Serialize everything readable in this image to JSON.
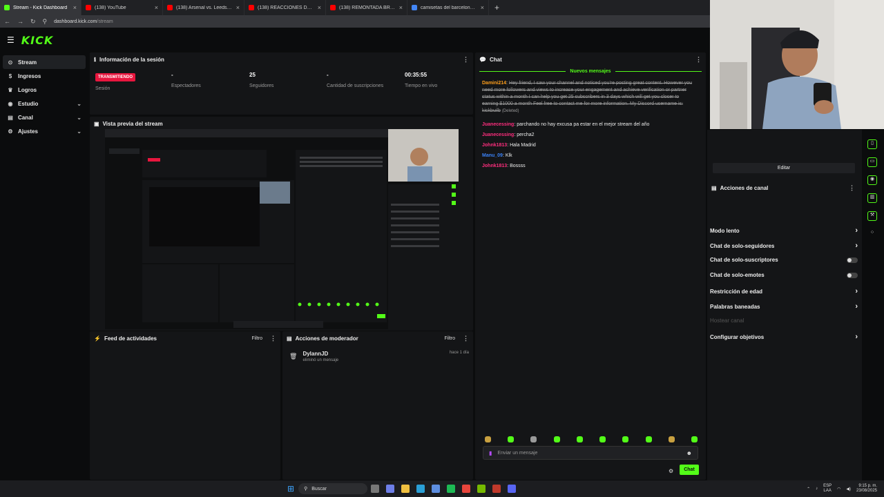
{
  "browser": {
    "tabs": [
      {
        "title": "Stream - Kick Dashboard",
        "color": "#53fc18"
      },
      {
        "title": "(138) YouTube",
        "color": "#ff0000"
      },
      {
        "title": "(138) Arsenal vs. Leeds | Highlig...",
        "color": "#ff0000"
      },
      {
        "title": "(138) REACCIONES DE UN HINC...",
        "color": "#ff0000"
      },
      {
        "title": "(138) REMONTADA BRUTAL DE...",
        "color": "#ff0000"
      },
      {
        "title": "camisetas del barcelona 2025 -",
        "color": "#4285f4"
      }
    ],
    "url_host": "dashboard.kick.com",
    "url_path": "/stream"
  },
  "app": {
    "logo": "KICK",
    "accent": "#53fc18"
  },
  "sidebar": {
    "items": [
      {
        "label": "Stream",
        "icon": "stream-icon",
        "active": true,
        "chev": ""
      },
      {
        "label": "Ingresos",
        "icon": "money-icon",
        "chev": ""
      },
      {
        "label": "Logros",
        "icon": "trophy-icon",
        "chev": ""
      },
      {
        "label": "Estudio",
        "icon": "studio-icon",
        "chev": "⌄"
      },
      {
        "label": "Canal",
        "icon": "channel-icon",
        "chev": "⌄"
      },
      {
        "label": "Ajustes",
        "icon": "settings-icon",
        "chev": "⌄"
      }
    ]
  },
  "session": {
    "title": "Información de la sesión",
    "live_badge": "TRANSMITIENDO",
    "stats": [
      {
        "value": "",
        "label": "Sesión"
      },
      {
        "value": "-",
        "label": "Espectadores"
      },
      {
        "value": "25",
        "label": "Seguidores"
      },
      {
        "value": "-",
        "label": "Cantidad de suscripciones"
      },
      {
        "value": "00:35:55",
        "label": "Tiempo en vivo"
      }
    ]
  },
  "preview": {
    "title": "Vista previa del stream"
  },
  "activity": {
    "title": "Feed de actividades",
    "filter": "Filtro"
  },
  "modactions": {
    "title": "Acciones de moderador",
    "filter": "Filtro",
    "entry": {
      "user": "DylannJD",
      "action": "eliminó un mensaje",
      "time": "hace 1 día"
    }
  },
  "chat": {
    "title": "Chat",
    "new_messages": "Nuevos mensajes",
    "messages": [
      {
        "user": "Damini214",
        "color": "#ff9f1c",
        "text": "Hey friend, I saw your channel and noticed you're posting great content. However you need more followers and views to increase your engagement and achieve verification or partner status within a month I can help you get 25 subscribers in 3 days which will get you closer to earning $1000 a month Feel free to contact me for more information. My Discord username is: kickbuilb",
        "deleted": "(Deleted)"
      },
      {
        "user": "Juanecessing",
        "color": "#ff2e7e",
        "text": "parchando no hay excusa pa estar en el mejor stream del año"
      },
      {
        "user": "Juanecessing",
        "color": "#ff2e7e",
        "text": "percha2"
      },
      {
        "user": "Johnk1813",
        "color": "#ff2e7e",
        "text": "Hala Madrid"
      },
      {
        "user": "Manu_09",
        "color": "#3b82f6",
        "text": "Klk"
      },
      {
        "user": "Johnk1813",
        "color": "#ff2e7e",
        "text": "Bossss"
      }
    ],
    "input_placeholder": "Enviar un mensaje",
    "send_label": "Chat"
  },
  "right_panel": {
    "edit_label": "Editar",
    "actions_title": "Acciones de canal",
    "items": [
      {
        "label": "Modo lento",
        "kind": "chevron"
      },
      {
        "label": "Chat de solo-seguidores",
        "kind": "chevron"
      },
      {
        "label": "Chat de solo-suscriptores",
        "kind": "toggle"
      },
      {
        "label": "Chat de solo-emotes",
        "kind": "toggle"
      },
      {
        "label": "Restricción de edad",
        "kind": "chevron"
      },
      {
        "label": "Palabras baneadas",
        "kind": "chevron"
      },
      {
        "label": "Hostear canal",
        "kind": "disabled"
      },
      {
        "label": "Configurar objetivos",
        "kind": "chevron"
      }
    ]
  },
  "taskbar": {
    "search": "Buscar",
    "lang": "ESP",
    "lang2": "LAA",
    "time": "9:15 p. m.",
    "date": "23/08/2025"
  }
}
